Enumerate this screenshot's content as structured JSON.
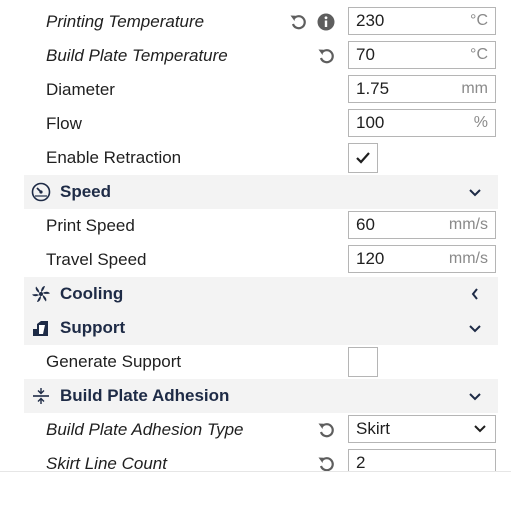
{
  "rows": {
    "printing_temperature": {
      "label": "Printing Temperature",
      "value": "230",
      "unit": "°C",
      "reset_icon": "reset-icon",
      "info_icon": "info-icon"
    },
    "build_plate_temperature": {
      "label": "Build Plate Temperature",
      "value": "70",
      "unit": "°C",
      "reset_icon": "reset-icon"
    },
    "diameter": {
      "label": "Diameter",
      "value": "1.75",
      "unit": "mm"
    },
    "flow": {
      "label": "Flow",
      "value": "100",
      "unit": "%"
    },
    "enable_retraction": {
      "label": "Enable Retraction",
      "checked": true
    },
    "print_speed": {
      "label": "Print Speed",
      "value": "60",
      "unit": "mm/s"
    },
    "travel_speed": {
      "label": "Travel Speed",
      "value": "120",
      "unit": "mm/s"
    },
    "generate_support": {
      "label": "Generate Support",
      "checked": false
    },
    "adhesion_type": {
      "label": "Build Plate Adhesion Type",
      "value": "Skirt",
      "reset_icon": "reset-icon"
    },
    "skirt_line_count": {
      "label": "Skirt Line Count",
      "value": "2",
      "reset_icon": "reset-icon"
    }
  },
  "categories": {
    "speed": {
      "title": "Speed",
      "icon": "speedometer-icon",
      "expanded": true
    },
    "cooling": {
      "title": "Cooling",
      "icon": "fan-icon",
      "expanded": false
    },
    "support": {
      "title": "Support",
      "icon": "support-icon",
      "expanded": true
    },
    "adhesion": {
      "title": "Build Plate Adhesion",
      "icon": "adhesion-icon",
      "expanded": true
    }
  },
  "colors": {
    "category_bg": "#f3f3f3",
    "category_text": "#1e2b46",
    "border": "#b5b5b5",
    "unit_text": "#8a8a8a",
    "icon": "#5e5e5e"
  }
}
